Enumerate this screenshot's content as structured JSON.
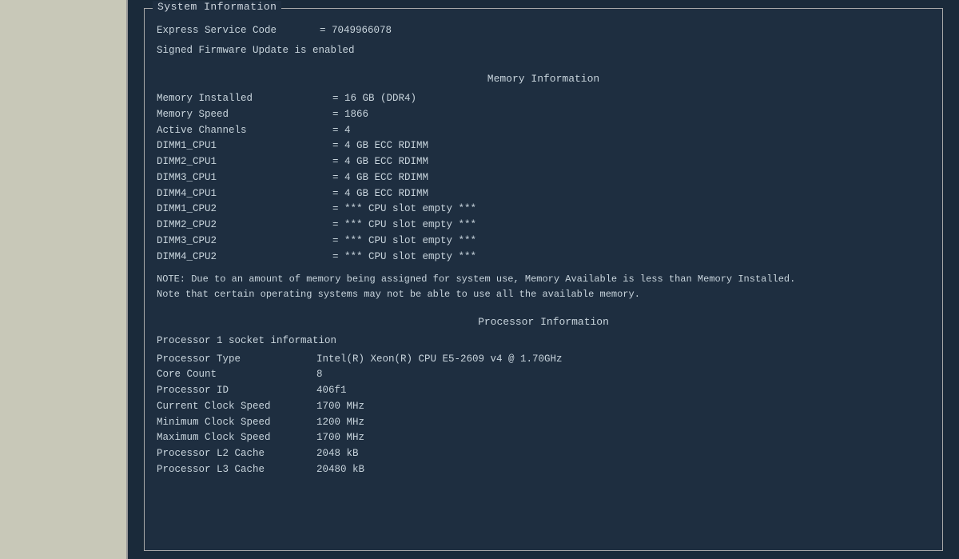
{
  "window": {
    "title": "System Information"
  },
  "system_info": {
    "section_title": "System Information",
    "express_service": {
      "label": "Express Service Code",
      "value": "= 7049966078"
    },
    "firmware": "Signed Firmware Update is enabled",
    "memory": {
      "section_title": "Memory Information",
      "rows": [
        {
          "label": "Memory Installed",
          "value": "= 16 GB (DDR4)"
        },
        {
          "label": "Memory Speed",
          "value": "= 1866"
        },
        {
          "label": "Active Channels",
          "value": "= 4"
        },
        {
          "label": "DIMM1_CPU1",
          "value": "= 4 GB ECC RDIMM"
        },
        {
          "label": "DIMM2_CPU1",
          "value": "= 4 GB ECC RDIMM"
        },
        {
          "label": "DIMM3_CPU1",
          "value": "= 4 GB ECC RDIMM"
        },
        {
          "label": "DIMM4_CPU1",
          "value": "= 4 GB ECC RDIMM"
        },
        {
          "label": "DIMM1_CPU2",
          "value": "= *** CPU slot empty ***"
        },
        {
          "label": "DIMM2_CPU2",
          "value": "= *** CPU slot empty ***"
        },
        {
          "label": "DIMM3_CPU2",
          "value": "= *** CPU slot empty ***"
        },
        {
          "label": "DIMM4_CPU2",
          "value": "= *** CPU slot empty ***"
        }
      ],
      "note": "NOTE: Due to an amount of memory being assigned for system use, Memory Available is less than Memory Installed. Note that certain operating systems may not be able to use all the available memory."
    },
    "processor": {
      "section_title": "Processor Information",
      "socket_label": "Processor 1 socket information",
      "rows": [
        {
          "label": "Processor Type",
          "value": "Intel(R) Xeon(R) CPU E5-2609 v4 @ 1.70GHz"
        },
        {
          "label": "Core Count",
          "value": "8"
        },
        {
          "label": "Processor ID",
          "value": "406f1"
        },
        {
          "label": "Current Clock Speed",
          "value": "1700 MHz"
        },
        {
          "label": "Minimum Clock Speed",
          "value": "1200 MHz"
        },
        {
          "label": "Maximum Clock Speed",
          "value": "1700 MHz"
        },
        {
          "label": "Processor L2 Cache",
          "value": "2048 kB"
        },
        {
          "label": "Processor L3 Cache",
          "value": "20480 kB"
        }
      ]
    }
  }
}
